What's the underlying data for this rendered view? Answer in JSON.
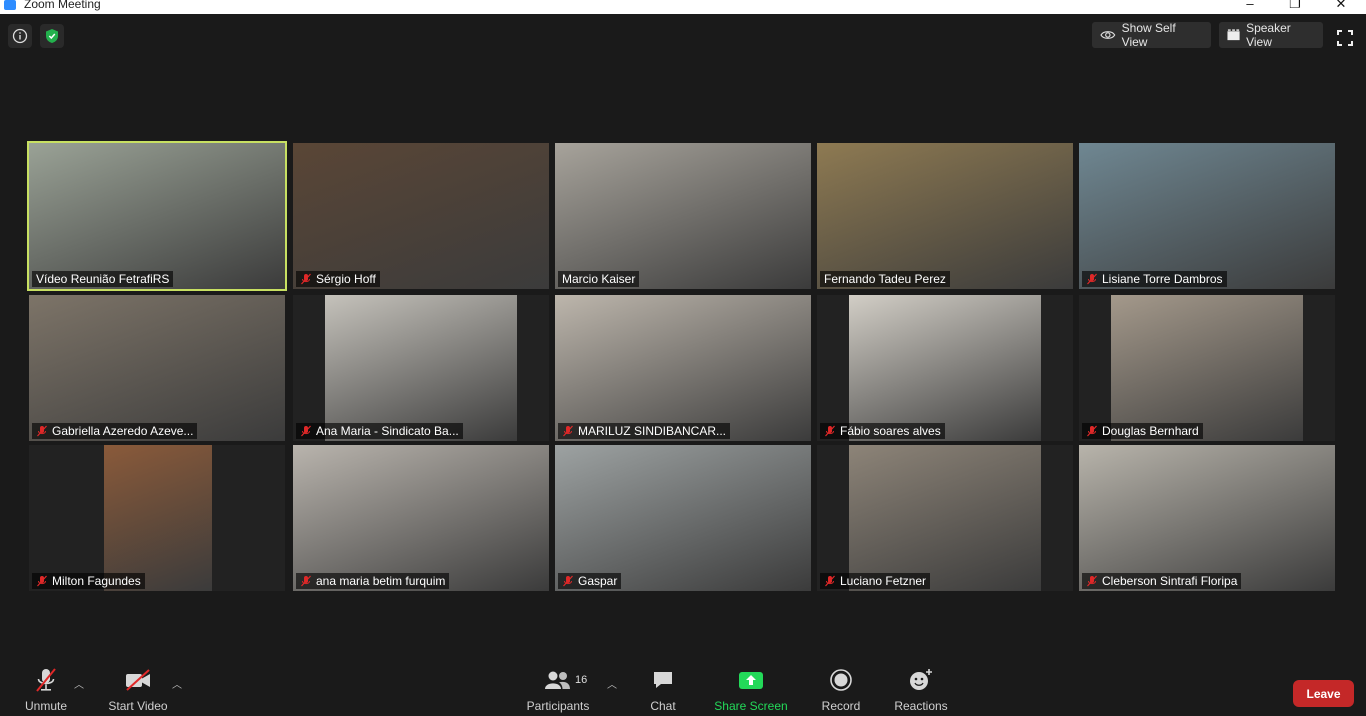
{
  "window": {
    "title": "Zoom Meeting",
    "controls": [
      "–",
      "❐",
      "✕"
    ]
  },
  "topbar": {
    "self_view_label": "Show Self View",
    "speaker_view_label": "Speaker View"
  },
  "participants": [
    {
      "name": "Vídeo Reunião FetrafiRS",
      "muted": false,
      "active": true,
      "bg": "#9aa296"
    },
    {
      "name": "Sérgio Hoff",
      "muted": true,
      "active": false,
      "bg": "#5a4636"
    },
    {
      "name": "Marcio Kaiser",
      "muted": false,
      "active": false,
      "bg": "#a7a39b"
    },
    {
      "name": "Fernando Tadeu Perez",
      "muted": false,
      "active": false,
      "bg": "#8e7a52"
    },
    {
      "name": "Lisiane Torre Dambros",
      "muted": true,
      "active": false,
      "bg": "#6f8792"
    },
    {
      "name": "Gabriella Azeredo Azeve...",
      "muted": true,
      "active": false,
      "bg": "#7d7468"
    },
    {
      "name": "Ana Maria - Sindicato Ba...",
      "muted": true,
      "active": false,
      "bg": "#c5c2bb"
    },
    {
      "name": "MARILUZ  SINDIBANCAR...",
      "muted": true,
      "active": false,
      "bg": "#bdb6ac"
    },
    {
      "name": "Fábio soares alves",
      "muted": true,
      "active": false,
      "bg": "#d2cec6"
    },
    {
      "name": "Douglas Bernhard",
      "muted": true,
      "active": false,
      "bg": "#a4998b"
    },
    {
      "name": "Milton Fagundes",
      "muted": true,
      "active": false,
      "bg": "#8a5a3a"
    },
    {
      "name": "ana maria betim furquim",
      "muted": true,
      "active": false,
      "bg": "#b9b4ad"
    },
    {
      "name": "Gaspar",
      "muted": true,
      "active": false,
      "bg": "#9da2a2"
    },
    {
      "name": "Luciano Fetzner",
      "muted": true,
      "active": false,
      "bg": "#8d8478"
    },
    {
      "name": "Cleberson Sintrafi Floripa",
      "muted": true,
      "active": false,
      "bg": "#b8b4ab"
    }
  ],
  "toolbar": {
    "unmute": "Unmute",
    "start_video": "Start Video",
    "participants": "Participants",
    "participants_count": "16",
    "chat": "Chat",
    "share_screen": "Share Screen",
    "record": "Record",
    "reactions": "Reactions",
    "leave": "Leave"
  },
  "colors": {
    "share_green": "#23d959",
    "leave_red": "#c42828",
    "active_outline": "#c8e062",
    "mic_red": "#e02828"
  }
}
